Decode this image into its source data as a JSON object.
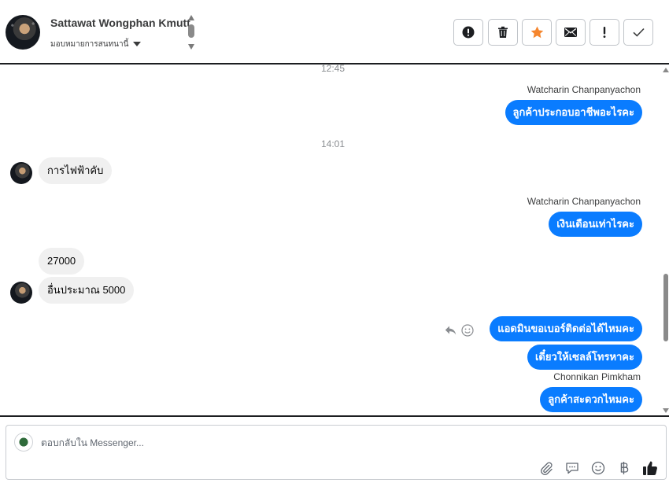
{
  "header": {
    "contact_name": "Sattawat Wongphan Kmutt",
    "assign_label": "มอบหมายการสนทนานี้",
    "toolbar": {
      "spam_icon": "alert-circle-icon",
      "delete_icon": "trash-icon",
      "star_icon": "star-icon",
      "mark_unread_icon": "envelope-icon",
      "follow_up_icon": "exclamation-icon",
      "done_icon": "check-icon"
    },
    "accent_star": "#f5862e"
  },
  "messages": {
    "time_1": "12:45",
    "sender_1": "Watcharin Chanpanyachon",
    "out_1": "ลูกค้าประกอบอาชีพอะไรคะ",
    "time_2": "14:01",
    "in_1": "การไฟฟ้าคับ",
    "sender_2": "Watcharin Chanpanyachon",
    "out_2": "เงินเดือนเท่าไรคะ",
    "in_2": "27000",
    "in_3": "อื่นประมาณ 5000",
    "out_3": "แอดมินขอเบอร์ติดต่อได้ไหมคะ",
    "out_4": "เดี๋ยวให้เซลล์โทรหาคะ",
    "sender_3": "Chonnikan Pimkham",
    "out_5": "ลูกค้าสะดวกไหมคะ"
  },
  "colors": {
    "outgoing_bubble": "#0a7cff",
    "incoming_bubble": "#f0f0f0"
  },
  "composer": {
    "placeholder": "ตอบกลับใน Messenger...",
    "icons": [
      "paperclip-icon",
      "saved-reply-icon",
      "emoji-icon",
      "baht-icon",
      "thumbs-up-icon"
    ]
  }
}
